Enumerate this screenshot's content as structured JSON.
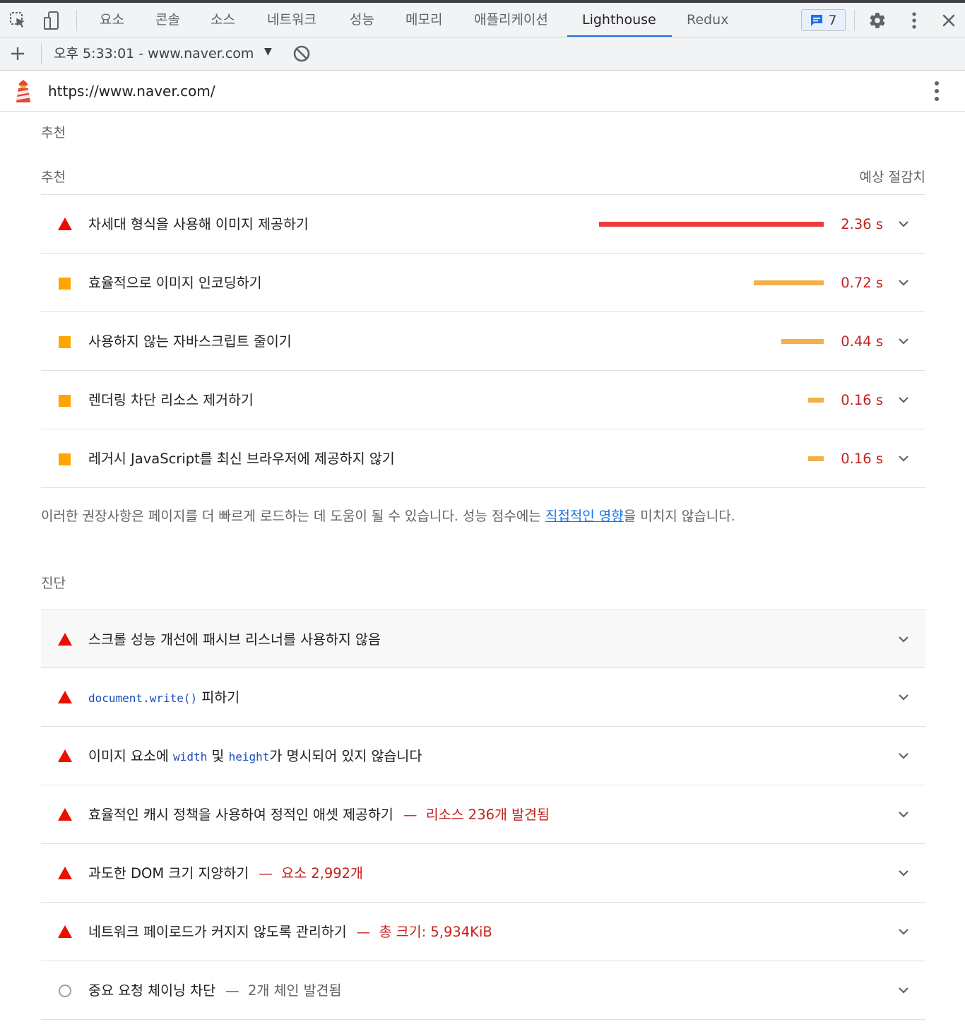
{
  "devtools": {
    "tabs": [
      "요소",
      "콘솔",
      "소스",
      "네트워크",
      "성능",
      "메모리",
      "애플리케이션",
      "Lighthouse",
      "Redux"
    ],
    "active_tab": "Lighthouse",
    "issues_count": "7"
  },
  "toolbar": {
    "run_label": "오후 5:33:01 - www.naver.com"
  },
  "urlbar": {
    "url": "https://www.naver.com/"
  },
  "opportunities": {
    "section_title": "추천",
    "column_left": "추천",
    "column_right": "예상 절감치",
    "items": [
      {
        "title": "차세대 형식을 사용해 이미지 제공하기",
        "savings": "2.36 s",
        "severity": "fail",
        "savings_fraction": 1.0
      },
      {
        "title": "효율적으로 이미지 인코딩하기",
        "savings": "0.72 s",
        "severity": "average",
        "savings_fraction": 0.31
      },
      {
        "title": "사용하지 않는 자바스크립트 줄이기",
        "savings": "0.44 s",
        "severity": "average",
        "savings_fraction": 0.19
      },
      {
        "title": "렌더링 차단 리소스 제거하기",
        "savings": "0.16 s",
        "severity": "average",
        "savings_fraction": 0.07
      },
      {
        "title": "레거시 JavaScript를 최신 브라우저에 제공하지 않기",
        "savings": "0.16 s",
        "severity": "average",
        "savings_fraction": 0.07
      }
    ],
    "note_before": "이러한 권장사항은 페이지를 더 빠르게 로드하는 데 도움이 될 수 있습니다. 성능 점수에는 ",
    "note_link": "직접적인 영향",
    "note_after": "을 미치지 않습니다."
  },
  "diagnostics": {
    "section_title": "진단",
    "items": [
      {
        "title": "스크롤 성능 개선에 패시브 리스너를 사용하지 않음",
        "severity": "fail"
      },
      {
        "code": "document.write()",
        "title_after": " 피하기",
        "severity": "fail"
      },
      {
        "title_before": "이미지 요소에 ",
        "code1": "width",
        "title_mid": " 및 ",
        "code2": "height",
        "title_after": "가 명시되어 있지 않습니다",
        "severity": "fail"
      },
      {
        "title": "효율적인 캐시 정책을 사용하여 정적인 애셋 제공하기",
        "detail": "리소스 236개 발견됨",
        "severity": "fail"
      },
      {
        "title": "과도한 DOM 크기 지양하기",
        "detail": "요소 2,992개",
        "severity": "fail"
      },
      {
        "title": "네트워크 페이로드가 커지지 않도록 관리하기",
        "detail": "총 크기: 5,934KiB",
        "severity": "fail"
      },
      {
        "title": "중요 요청 체이닝 차단",
        "detail": "2개 체인 발견됨",
        "severity": "informative"
      }
    ],
    "separator": "—"
  },
  "colors": {
    "fail": "#eb0f00",
    "average": "#ffa400",
    "savings_text": "#c5221f",
    "link": "#1a73e8",
    "active_tab_underline": "#1a73e8"
  },
  "icons": [
    "inspect-element-icon",
    "device-toolbar-icon",
    "issues-chat-icon",
    "settings-gear-icon",
    "more-vert-icon",
    "close-icon",
    "add-icon",
    "clear-icon",
    "lighthouse-logo-icon",
    "chevron-down-icon"
  ]
}
